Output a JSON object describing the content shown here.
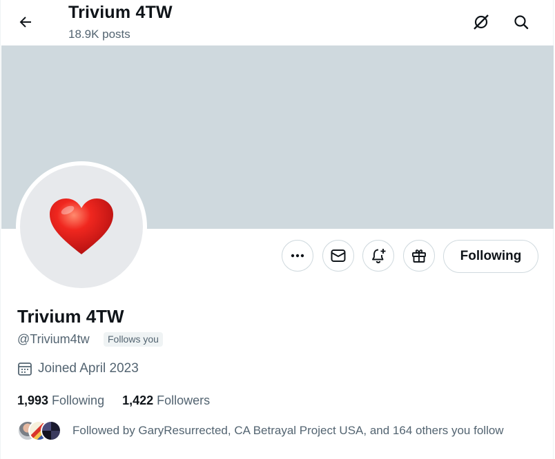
{
  "header": {
    "name": "Trivium 4TW",
    "posts": "18.9K posts",
    "icons": [
      "back-arrow-icon",
      "grok-icon",
      "search-icon"
    ]
  },
  "profile": {
    "display_name": "Trivium 4TW",
    "handle": "@Trivium4tw",
    "follows_you": "Follows you",
    "joined": "Joined April 2023",
    "avatar_icon": "red-heart-icon",
    "banner_color": "#cfd9de"
  },
  "actions": {
    "more_icon": "more-icon",
    "message_icon": "envelope-icon",
    "notify_icon": "bell-plus-icon",
    "gift_icon": "gift-icon",
    "following_label": "Following"
  },
  "stats": {
    "following_count": "1,993",
    "following_label": "Following",
    "followers_count": "1,422",
    "followers_label": "Followers"
  },
  "followed_by": {
    "text": "Followed by GaryResurrected, CA Betrayal Project USA, and 164 others you follow"
  },
  "colors": {
    "text_primary": "#0f1419",
    "text_secondary": "#536471",
    "border": "#cfd9de",
    "heart": "#e0241f"
  }
}
